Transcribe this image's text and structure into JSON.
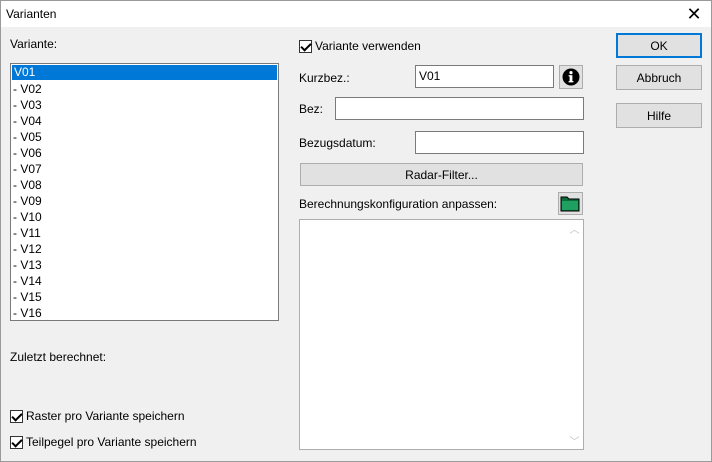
{
  "window": {
    "title": "Varianten"
  },
  "left": {
    "variant_label": "Variante:",
    "variants": [
      "V01",
      "- V02",
      "- V03",
      "- V04",
      "- V05",
      "- V06",
      "- V07",
      "- V08",
      "- V09",
      "- V10",
      "- V11",
      "- V12",
      "- V13",
      "- V14",
      "- V15",
      "- V16"
    ],
    "selected_variant": "V01",
    "last_calc_label": "Zuletzt berechnet:",
    "raster_label": "Raster pro Variante speichern",
    "raster_checked": true,
    "teilpegel_label": "Teilpegel pro Variante speichern",
    "teilpegel_checked": true
  },
  "middle": {
    "use_variant_label": "Variante verwenden",
    "use_variant_checked": true,
    "kurzbez_label": "Kurzbez.:",
    "kurzbez_value": "V01",
    "bez_label": "Bez:",
    "bez_value": "",
    "bezugsdatum_label": "Bezugsdatum:",
    "bezugsdatum_value": "",
    "radar_filter_label": "Radar-Filter...",
    "berechnung_label": "Berechnungskonfiguration anpassen:",
    "berechnung_text": ""
  },
  "buttons": {
    "ok": "OK",
    "abbruch": "Abbruch",
    "hilfe": "Hilfe"
  },
  "icons": {
    "close": "close-icon",
    "info": "info-icon",
    "folder": "folder-icon"
  }
}
